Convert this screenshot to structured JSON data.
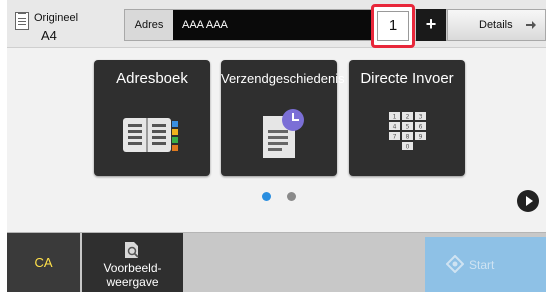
{
  "header": {
    "original_label": "Origineel",
    "original_value": "A4",
    "address_label": "Adres",
    "address_value": "AAA AAA",
    "copies": "1",
    "plus_label": "+",
    "details_label": "Details"
  },
  "tiles": [
    {
      "label": "Adresboek",
      "icon": "address-book-icon"
    },
    {
      "label": "Verzendgeschiedenis",
      "icon": "send-history-icon"
    },
    {
      "label": "Directe Invoer",
      "icon": "keypad-icon"
    }
  ],
  "pager": {
    "active_color": "#2a8ee0",
    "inactive_color": "#8a8a8a"
  },
  "keypad_keys": [
    "1",
    "2",
    "3",
    "4",
    "5",
    "6",
    "7",
    "8",
    "9",
    "0"
  ],
  "footer": {
    "ca_label": "CA",
    "preview_label_line1": "Voorbeeld-",
    "preview_label_line2": "weergave",
    "start_label": "Start"
  },
  "colors": {
    "highlight": "#e8273a",
    "ca_text": "#ffe04a",
    "start_bg": "#8ec1e6",
    "tile_bg": "#2f2f2f"
  }
}
